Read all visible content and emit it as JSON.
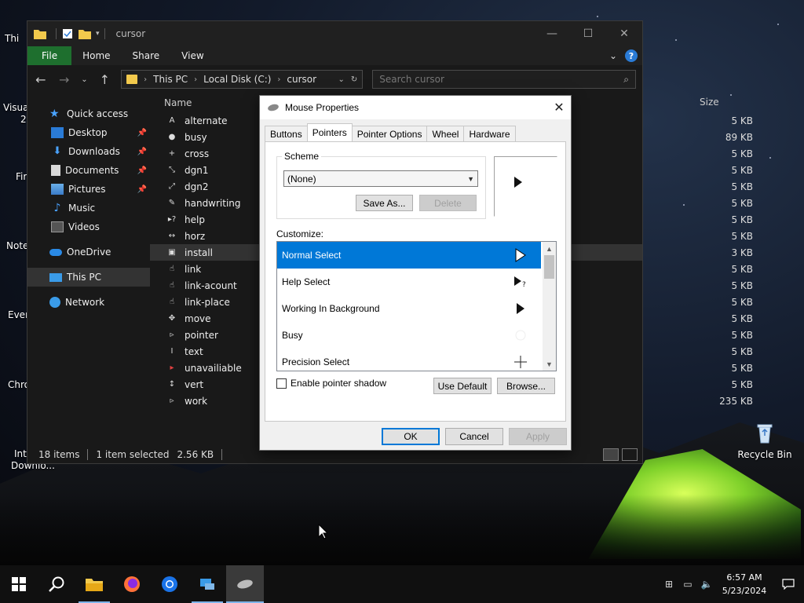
{
  "desktop": {
    "left_labels": [
      "Thi",
      "Visua",
      "2",
      "Fir",
      "Note",
      "Ever",
      "Chro",
      "Int",
      "Downlo..."
    ],
    "recycle_bin": "Recycle Bin"
  },
  "explorer": {
    "title": "cursor",
    "ribbon": {
      "file": "File",
      "home": "Home",
      "share": "Share",
      "view": "View"
    },
    "address": {
      "segments": [
        "This PC",
        "Local Disk (C:)",
        "cursor"
      ]
    },
    "search_placeholder": "Search cursor",
    "nav": {
      "quick_access": "Quick access",
      "desktop": "Desktop",
      "downloads": "Downloads",
      "documents": "Documents",
      "pictures": "Pictures",
      "music": "Music",
      "videos": "Videos",
      "onedrive": "OneDrive",
      "this_pc": "This PC",
      "network": "Network"
    },
    "columns": {
      "name": "Name",
      "size": "Size"
    },
    "files": [
      {
        "name": "alternate",
        "size": "5 KB"
      },
      {
        "name": "busy",
        "size": "89 KB"
      },
      {
        "name": "cross",
        "size": "5 KB"
      },
      {
        "name": "dgn1",
        "size": "5 KB"
      },
      {
        "name": "dgn2",
        "size": "5 KB"
      },
      {
        "name": "handwriting",
        "size": "5 KB"
      },
      {
        "name": "help",
        "size": "5 KB"
      },
      {
        "name": "horz",
        "size": "5 KB"
      },
      {
        "name": "install",
        "size": "3 KB"
      },
      {
        "name": "link",
        "size": "5 KB"
      },
      {
        "name": "link-acount",
        "size": "5 KB"
      },
      {
        "name": "link-place",
        "size": "5 KB"
      },
      {
        "name": "move",
        "size": "5 KB"
      },
      {
        "name": "pointer",
        "size": "5 KB"
      },
      {
        "name": "text",
        "size": "5 KB"
      },
      {
        "name": "unavailiable",
        "size": "5 KB"
      },
      {
        "name": "vert",
        "size": "5 KB"
      },
      {
        "name": "work",
        "size": "235 KB"
      }
    ],
    "status": {
      "items": "18 items",
      "selected": "1 item selected",
      "selected_size": "2.56 KB"
    }
  },
  "dialog": {
    "title": "Mouse Properties",
    "tabs": [
      "Buttons",
      "Pointers",
      "Pointer Options",
      "Wheel",
      "Hardware"
    ],
    "scheme_label": "Scheme",
    "scheme_value": "(None)",
    "save_as": "Save As...",
    "delete": "Delete",
    "customize_label": "Customize:",
    "cursor_items": [
      "Normal Select",
      "Help Select",
      "Working In Background",
      "Busy",
      "Precision Select"
    ],
    "shadow_label": "Enable pointer shadow",
    "use_default": "Use Default",
    "browse": "Browse...",
    "ok": "OK",
    "cancel": "Cancel",
    "apply": "Apply"
  },
  "taskbar": {
    "time": "6:57 AM",
    "date": "5/23/2024"
  },
  "colors": {
    "file_tab": "#1e6f2e",
    "selection": "#0078d7",
    "taskbar": "#101010"
  }
}
